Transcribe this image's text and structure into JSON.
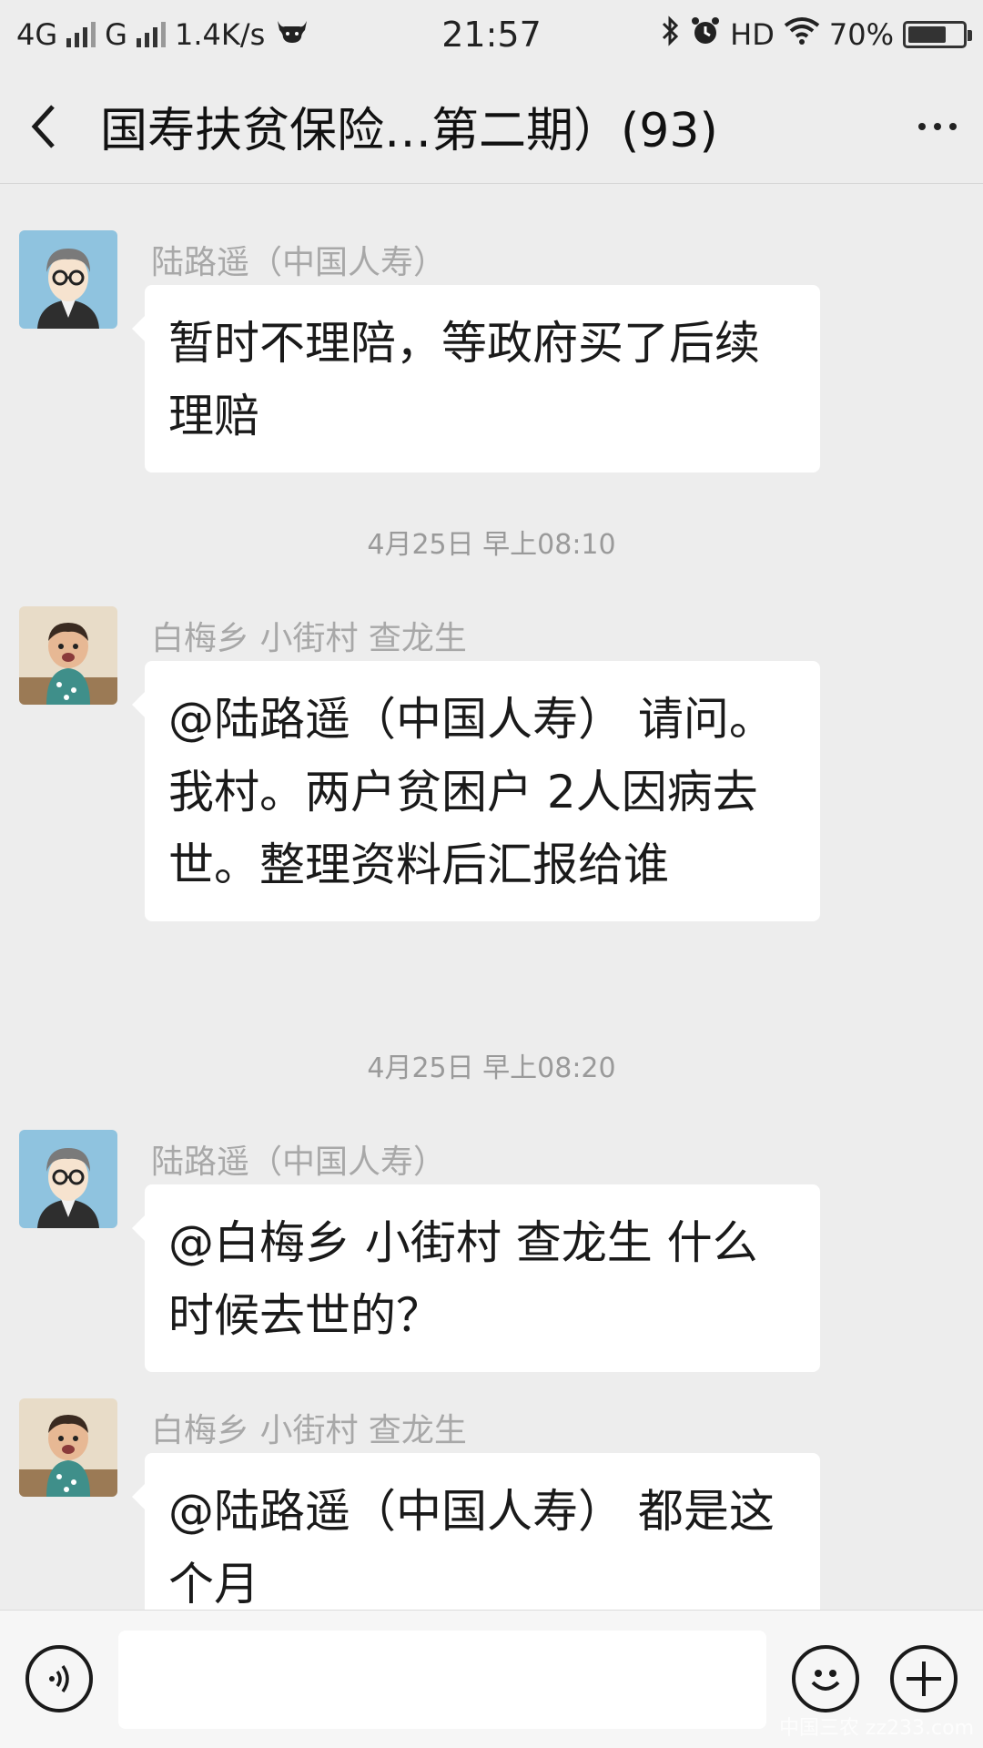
{
  "status_bar": {
    "network_1": "4G",
    "network_2": "G",
    "speed": "1.4K/s",
    "time": "21:57",
    "hd": "HD",
    "battery": "70%",
    "battery_level": 0.7
  },
  "header": {
    "title": "国寿扶贫保险…第二期）(93)"
  },
  "messages": [
    {
      "sender": "陆路遥（中国人寿）",
      "text": "暂时不理陪，等政府买了后续理赔"
    },
    {
      "sender": "白梅乡 小街村 查龙生",
      "text": "@陆路遥（中国人寿） 请问。我村。两户贫困户 2人因病去世。整理资料后汇报给谁"
    },
    {
      "sender": "陆路遥（中国人寿）",
      "text": "@白梅乡 小街村 查龙生  什么时候去世的？"
    },
    {
      "sender": "白梅乡 小街村 查龙生",
      "text": "@陆路遥（中国人寿） 都是这个月"
    }
  ],
  "timestamps": [
    "4月25日 早上08:10",
    "4月25日 早上08:20"
  ],
  "input": {
    "value": ""
  },
  "watermark": "中国三农 zz233.com"
}
